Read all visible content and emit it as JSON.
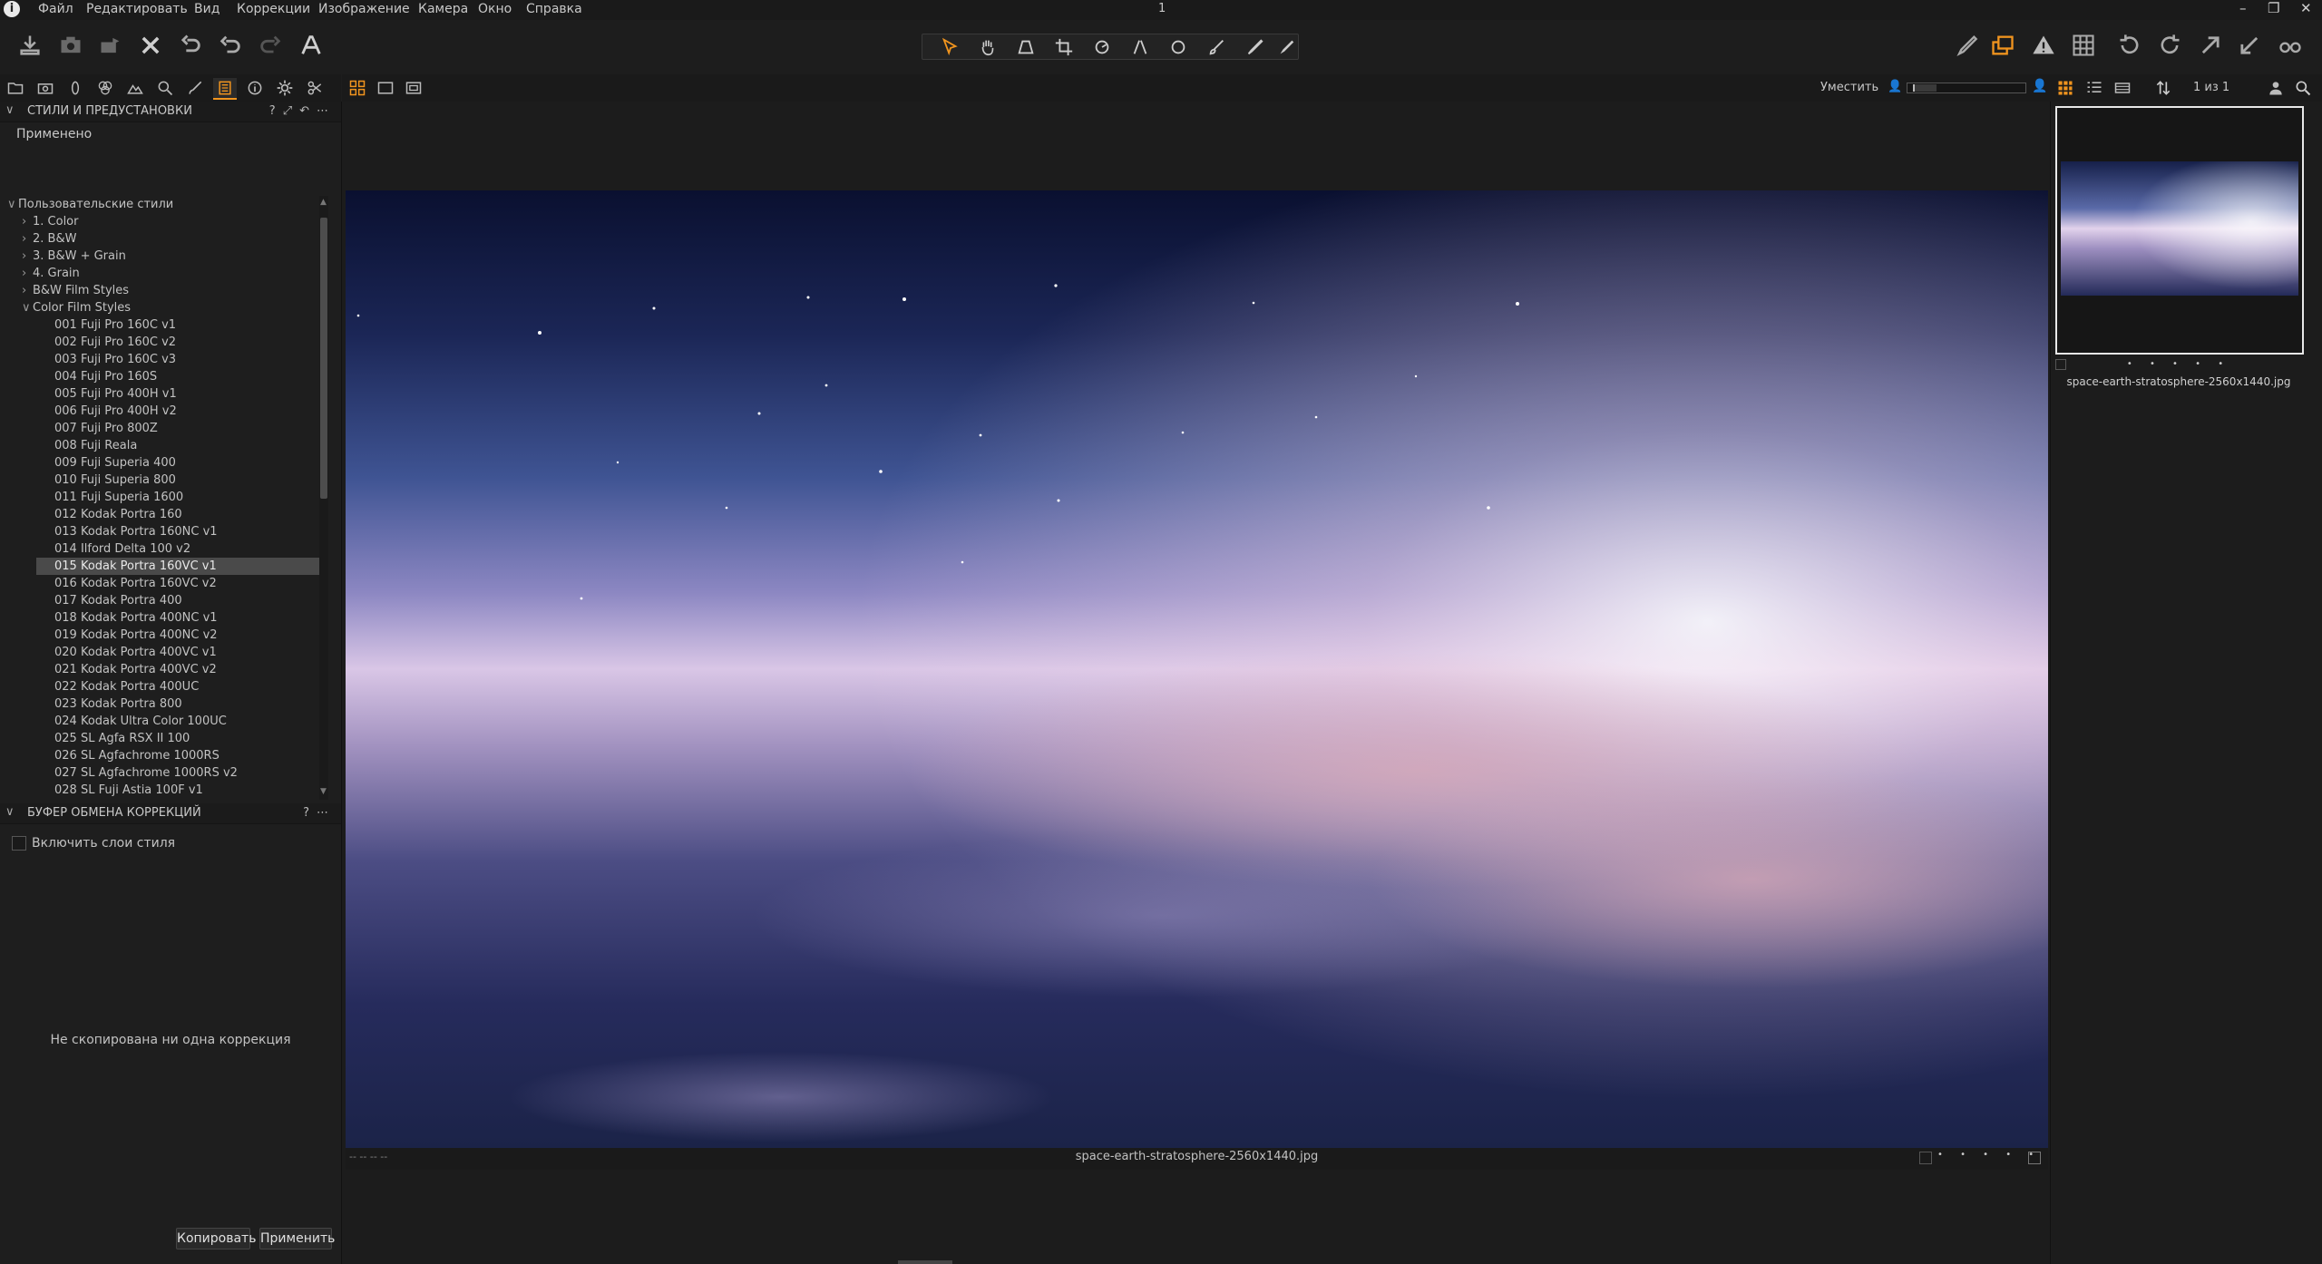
{
  "window": {
    "title": "1",
    "controls": [
      "–",
      "❐",
      "✕"
    ]
  },
  "menubar": {
    "items": [
      "Файл",
      "Редактировать",
      "Вид",
      "Коррекции",
      "Изображение",
      "Камера",
      "Окно",
      "Справка"
    ]
  },
  "toolbar": {
    "left_icons": [
      "import-icon",
      "capture-icon",
      "process-icon",
      "delete-icon",
      "undo-all-icon",
      "undo-icon",
      "redo-icon",
      "text-overlay-icon"
    ],
    "cursor_tools": [
      "select-cursor-icon",
      "pan-hand-icon",
      "keystone-icon",
      "crop-icon",
      "rotate-icon",
      "straighten-icon",
      "spot-removal-icon",
      "brush-icon",
      "eraser-icon",
      "picker-icon"
    ],
    "right_icons": [
      "edit-icon",
      "layers-icon",
      "exposure-warning-icon",
      "grid-icon",
      "rotate-left-icon",
      "rotate-right-icon",
      "share-icon",
      "copy-apply-icon",
      "proof-icon"
    ]
  },
  "styles_panel": {
    "title": "СТИЛИ И ПРЕДУСТАНОВКИ",
    "applied_label": "Применено",
    "tree_root": "Пользовательские стили",
    "groups": [
      "1. Color",
      "2. B&W",
      "3. B&W + Grain",
      "4. Grain",
      "B&W Film Styles",
      "Color Film Styles"
    ],
    "items": [
      "001 Fuji Pro 160C v1",
      "002 Fuji Pro 160C v2",
      "003 Fuji Pro 160C v3",
      "004 Fuji Pro 160S",
      "005 Fuji Pro 400H v1",
      "006 Fuji Pro 400H v2",
      "007 Fuji Pro 800Z",
      "008 Fuji Reala",
      "009 Fuji Superia 400",
      "010 Fuji Superia 800",
      "011 Fuji Superia 1600",
      "012 Kodak Portra 160",
      "013 Kodak Portra 160NC v1",
      "014 Ilford Delta 100 v2",
      "015 Kodak Portra 160VC v1",
      "016 Kodak Portra 160VC v2",
      "017 Kodak Portra 400",
      "018 Kodak Portra 400NC v1",
      "019 Kodak Portra 400NC v2",
      "020 Kodak Portra 400VC v1",
      "021 Kodak Portra 400VC v2",
      "022 Kodak Portra 400UC",
      "023 Kodak Portra 800",
      "024 Kodak Ultra Color 100UC",
      "025 SL Agfa RSX II 100",
      "026 SL Agfachrome 1000RS",
      "027 SL Agfachrome 1000RS v2",
      "028 SL Fuji Astia 100F v1"
    ],
    "selected_index": 14
  },
  "clipboard_panel": {
    "title": "БУФЕР ОБМЕНА КОРРЕКЦИЙ",
    "include_layers_label": "Включить слои стиля",
    "empty_message": "Не скопирована ни одна коррекция",
    "copy_button": "Копировать",
    "apply_button": "Применить"
  },
  "viewer": {
    "zoom_label": "Уместить",
    "coords": "-- -- -- --",
    "filename": "space-earth-stratosphere-2560x1440.jpg"
  },
  "browser": {
    "count": "1 из 1",
    "thumb_filename": "space-earth-stratosphere-2560x1440.jpg",
    "rating_dots": "• • • • •"
  }
}
